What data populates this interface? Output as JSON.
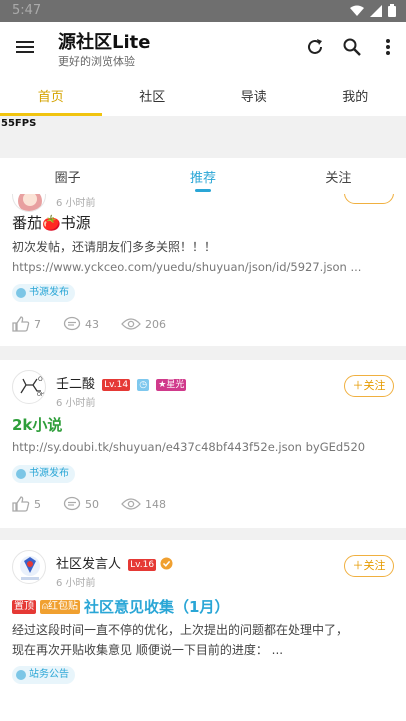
{
  "status_bar": {
    "time": "5:47",
    "icons": [
      "wifi-icon",
      "signal-icon",
      "battery-icon"
    ]
  },
  "app_bar": {
    "title": "源社区Lite",
    "subtitle": "更好的浏览体验",
    "actions": [
      "refresh-icon",
      "search-icon",
      "more-vert-icon"
    ]
  },
  "main_tabs": [
    "首页",
    "社区",
    "导读",
    "我的"
  ],
  "fps_label": "55FPS",
  "sub_tabs": [
    "圈子",
    "推荐",
    "关注"
  ],
  "colors": {
    "accent_yellow": "#f1c40f",
    "accent_blue": "#2aa6d6",
    "follow_orange": "#e69a00",
    "title_green": "#2e9e3a"
  },
  "posts": [
    {
      "time": "6 小时前",
      "title": "番茄🍅书源",
      "excerpt": "初次发帖，还请朋友们多多关照！！！",
      "link": "https://www.yckceo.com/yuedu/shuyuan/json/id/5927.json ...",
      "tag": "书源发布",
      "likes": "7",
      "comments": "43",
      "views": "206"
    },
    {
      "author": "壬二酸",
      "level": "Lv.14",
      "star_badge": "★星光",
      "time": "6 小时前",
      "follow": "关注",
      "title": "2k小说",
      "link": "http://sy.doubi.tk/shuyuan/e437c48bf443f52e.json byGEd520",
      "tag": "书源发布",
      "likes": "5",
      "comments": "50",
      "views": "148"
    },
    {
      "author": "社区发言人",
      "level": "Lv.16",
      "time": "6 小时前",
      "follow": "关注",
      "pin_label": "置顶",
      "redpack_label": "红包贴",
      "title": "社区意见收集（1月）",
      "excerpt_line1": "经过这段时间一直不停的优化，上次提出的问题都在处理中了，",
      "excerpt_line2": "现在再次开贴收集意见 顺便说一下目前的进度：  ...",
      "tag": "站务公告"
    }
  ]
}
